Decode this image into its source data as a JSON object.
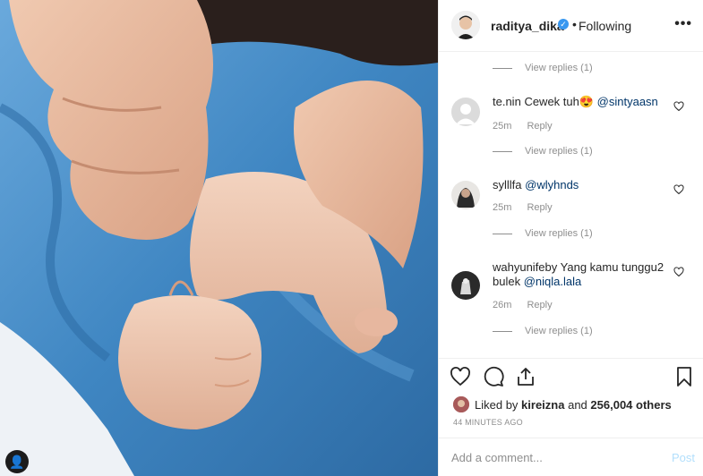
{
  "post": {
    "username": "raditya_dika",
    "verified_icon": "verified-badge-icon",
    "separator": "•",
    "follow_status": "Following",
    "more_icon": "ellipsis-icon",
    "more_glyph": "•••"
  },
  "comments": [
    {
      "type": "view_replies",
      "label": "View replies (1)"
    },
    {
      "type": "comment",
      "username": "te.nin",
      "text": "Cewek tuh😍",
      "mention": "@sintyaasn",
      "time": "25m",
      "reply": "Reply"
    },
    {
      "type": "view_replies",
      "label": "View replies (1)"
    },
    {
      "type": "comment",
      "username": "sylllfa",
      "text": "",
      "mention": "@wlyhnds",
      "time": "25m",
      "reply": "Reply"
    },
    {
      "type": "view_replies",
      "label": "View replies (1)"
    },
    {
      "type": "comment",
      "username": "wahyunifeby",
      "text": "Yang kamu tunggu2 bulek",
      "mention": "@niqla.lala",
      "time": "26m",
      "reply": "Reply"
    },
    {
      "type": "view_replies",
      "label": "View replies (1)"
    }
  ],
  "likes": {
    "prefix": "Liked by",
    "user": "kireizna",
    "middle": "and",
    "count": "256,004 others"
  },
  "timestamp": "44 MINUTES AGO",
  "add_comment": {
    "placeholder": "Add a comment...",
    "post_label": "Post"
  },
  "colors": {
    "blanket_blue": "#3f86c2",
    "link": "#003569",
    "muted": "#8e8e8e",
    "verified": "#3897f0",
    "post_disabled": "#b2dffc"
  }
}
